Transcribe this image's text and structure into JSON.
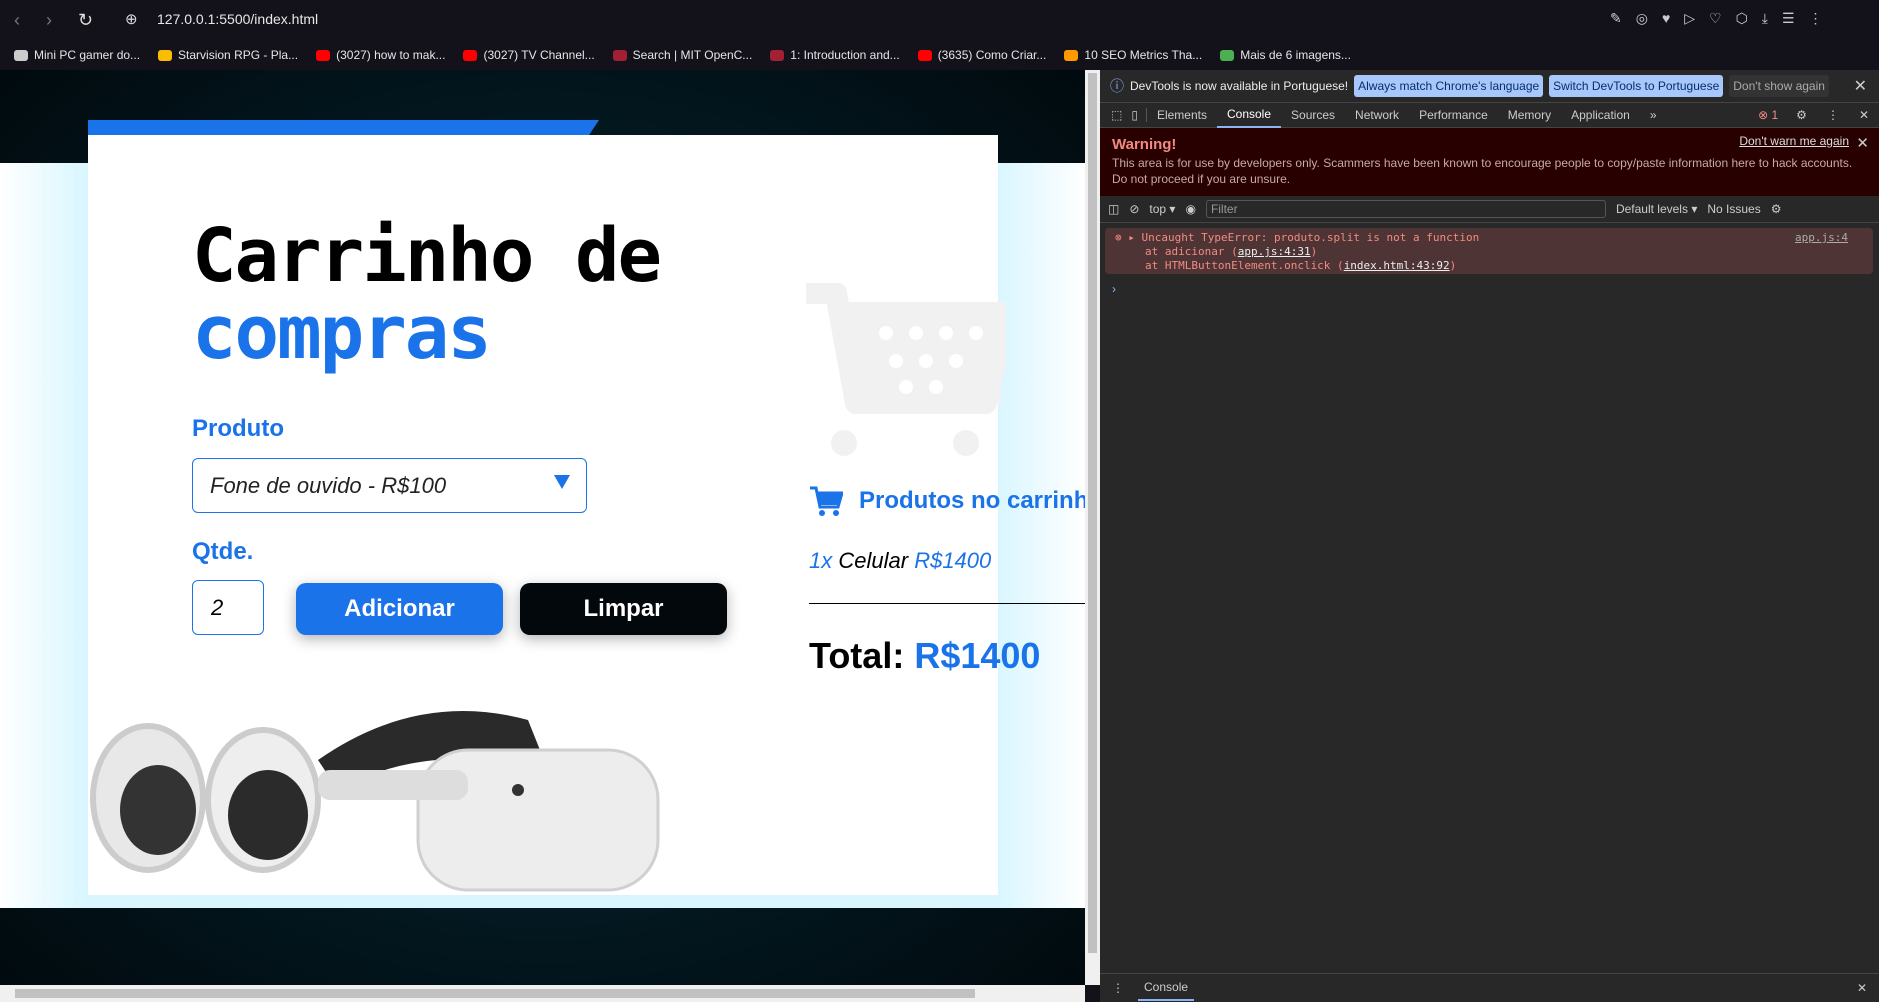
{
  "browser": {
    "url": "127.0.0.1:5500/index.html",
    "bookmarks": [
      {
        "label": "Mini PC gamer do...",
        "icon": "folder-icon",
        "color": "#cccccc"
      },
      {
        "label": "Starvision RPG - Pla...",
        "icon": "drive-icon",
        "color": "#fbbc04"
      },
      {
        "label": "(3027) how to mak...",
        "icon": "youtube-icon",
        "color": "#ff0000"
      },
      {
        "label": "(3027) TV Channel...",
        "icon": "youtube-icon",
        "color": "#ff0000"
      },
      {
        "label": "Search | MIT OpenC...",
        "icon": "mit-ocw-icon",
        "color": "#a31f34"
      },
      {
        "label": "1: Introduction and...",
        "icon": "mit-ocw-icon",
        "color": "#a31f34"
      },
      {
        "label": "(3635) Como Criar...",
        "icon": "youtube-icon",
        "color": "#ff0000"
      },
      {
        "label": "10 SEO Metrics Tha...",
        "icon": "amazon-icon",
        "color": "#ff9900"
      },
      {
        "label": "Mais de 6 imagens...",
        "icon": "px-icon",
        "color": "#4caf50"
      }
    ]
  },
  "app": {
    "title_line1": "Carrinho de",
    "title_line2": "compras",
    "product_label": "Produto",
    "product_selected": "Fone de ouvido - R$100",
    "qty_label": "Qtde.",
    "qty_value": "2",
    "add_button": "Adicionar",
    "clear_button": "Limpar",
    "cart_heading": "Produtos no carrinho",
    "cart_items": [
      {
        "qty": "1x",
        "name": "Celular",
        "price": "R$1400"
      }
    ],
    "total_label": "Total:",
    "total_value": "R$1400",
    "accent": "#1a73e8"
  },
  "devtools": {
    "infobar": {
      "text": "DevTools is now available in Portuguese!",
      "btn1": "Always match Chrome's language",
      "btn2": "Switch DevTools to Portuguese",
      "btn3": "Don't show again"
    },
    "tabs": [
      "Elements",
      "Console",
      "Sources",
      "Network",
      "Performance",
      "Memory",
      "Application"
    ],
    "active_tab": "Console",
    "error_count": "1",
    "warning": {
      "title": "Warning!",
      "text": "This area is for use by developers only. Scammers have been known to encourage people to copy/paste information here to hack accounts. Do not proceed if you are unsure.",
      "dismiss": "Don't warn me again"
    },
    "toolbar": {
      "context": "top",
      "filter_placeholder": "Filter",
      "levels": "Default levels",
      "issues": "No Issues"
    },
    "error": {
      "message": "Uncaught TypeError: produto.split is not a function",
      "line2_prefix": "at adicionar (",
      "line2_link": "app.js:4:31",
      "line3_prefix": "at HTMLButtonElement.onclick (",
      "line3_link": "index.html:43:92",
      "source": "app.js:4"
    },
    "drawer_tab": "Console"
  }
}
